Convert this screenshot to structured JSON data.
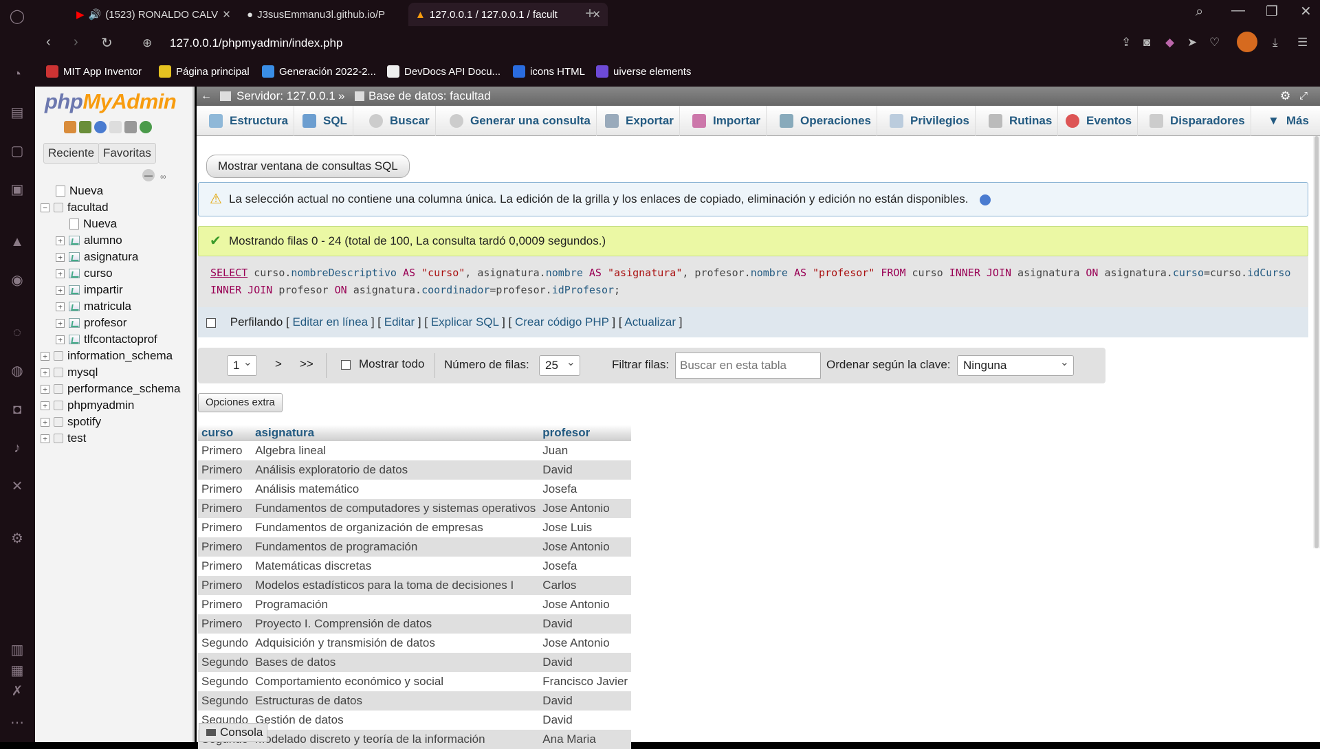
{
  "browser": {
    "tabs": [
      {
        "title": "(1523) RONALDO CALV",
        "icon": "youtube-icon"
      },
      {
        "title": "J3susEmmanu3l.github.io/P",
        "icon": "github-icon"
      },
      {
        "title": "127.0.0.1 / 127.0.0.1 / facult",
        "icon": "phpmyadmin-icon"
      }
    ],
    "url": "127.0.0.1/phpmyadmin/index.php",
    "bookmarks": [
      "MIT App Inventor",
      "Página principal",
      "Generación 2022-2...",
      "DevDocs API Docu...",
      "icons HTML",
      "uiverse elements"
    ]
  },
  "sidebar": {
    "logo_php": "php",
    "logo_myadmin": "MyAdmin",
    "tabs": [
      "Reciente",
      "Favoritas"
    ],
    "tree": {
      "new_root": "Nueva",
      "db_facultad": "facultad",
      "new_table": "Nueva",
      "tables": [
        "alumno",
        "asignatura",
        "curso",
        "impartir",
        "matricula",
        "profesor",
        "tlfcontactoprof"
      ],
      "databases": [
        "information_schema",
        "mysql",
        "performance_schema",
        "phpmyadmin",
        "spotify",
        "test"
      ]
    }
  },
  "breadcrumb": {
    "server": "Servidor: 127.0.0.1",
    "sep": "»",
    "database": "Base de datos: facultad"
  },
  "menu": [
    "Estructura",
    "SQL",
    "Buscar",
    "Generar una consulta",
    "Exportar",
    "Importar",
    "Operaciones",
    "Privilegios",
    "Rutinas",
    "Eventos",
    "Disparadores",
    "Más"
  ],
  "sql_window_button": "Mostrar ventana de consultas SQL",
  "notice": "La selección actual no contiene una columna única. La edición de la grilla y los enlaces de copiado, eliminación y edición no están disponibles.",
  "success": "Mostrando filas 0 - 24 (total de 100, La consulta tardó 0,0009 segundos.)",
  "profiling": {
    "label": "Perfilando",
    "links": [
      "Editar en línea",
      "Editar",
      "Explicar SQL",
      "Crear código PHP",
      "Actualizar"
    ]
  },
  "nav": {
    "page": "1",
    "next": ">",
    "last": ">>",
    "show_all": "Mostrar todo",
    "rows_label": "Número de filas:",
    "rows_value": "25",
    "filter_label": "Filtrar filas:",
    "filter_placeholder": "Buscar en esta tabla",
    "sort_label": "Ordenar según la clave:",
    "sort_value": "Ninguna"
  },
  "extra_options": "Opciones extra",
  "table": {
    "headers": [
      "curso",
      "asignatura",
      "profesor"
    ],
    "rows": [
      [
        "Primero",
        "Algebra lineal",
        "Juan"
      ],
      [
        "Primero",
        "Análisis exploratorio de datos",
        "David"
      ],
      [
        "Primero",
        "Análisis matemático",
        "Josefa"
      ],
      [
        "Primero",
        "Fundamentos de computadores y sistemas operativos",
        "Jose Antonio"
      ],
      [
        "Primero",
        "Fundamentos de organización de empresas",
        "Jose Luis"
      ],
      [
        "Primero",
        "Fundamentos de programación",
        "Jose Antonio"
      ],
      [
        "Primero",
        "Matemáticas discretas",
        "Josefa"
      ],
      [
        "Primero",
        "Modelos estadísticos para la toma de decisiones I",
        "Carlos"
      ],
      [
        "Primero",
        "Programación",
        "Jose Antonio"
      ],
      [
        "Primero",
        "Proyecto I. Comprensión de datos",
        "David"
      ],
      [
        "Segundo",
        "Adquisición y transmisión de datos",
        "Jose Antonio"
      ],
      [
        "Segundo",
        "Bases de datos",
        "David"
      ],
      [
        "Segundo",
        "Comportamiento económico y social",
        "Francisco Javier"
      ],
      [
        "Segundo",
        "Estructuras de datos",
        "David"
      ],
      [
        "Segundo",
        "Gestión de datos",
        "David"
      ],
      [
        "Segundo",
        "Modelado discreto y teoría de la información",
        "Ana Maria"
      ]
    ]
  },
  "console_label": "Consola"
}
